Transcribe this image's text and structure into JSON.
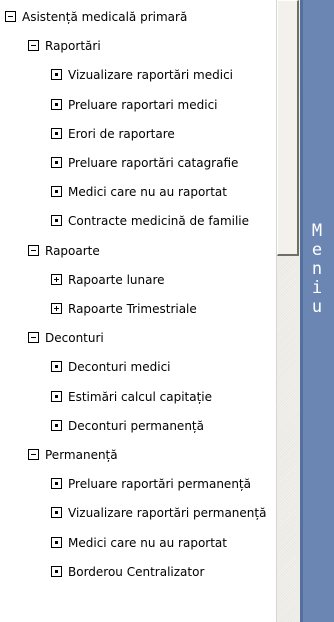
{
  "menu": {
    "title": "Meniu",
    "letters": [
      "M",
      "e",
      "n",
      "i",
      "u"
    ]
  },
  "tree": [
    {
      "label": "Asistență medicală primară",
      "state": "expanded",
      "level": 0
    },
    {
      "label": "Raportări",
      "state": "expanded",
      "level": 1
    },
    {
      "label": "Vizualizare raportări medici",
      "state": "leaf",
      "level": 2
    },
    {
      "label": "Preluare raportari medici",
      "state": "leaf",
      "level": 2
    },
    {
      "label": "Erori de raportare",
      "state": "leaf",
      "level": 2
    },
    {
      "label": "Preluare raportări catagrafie",
      "state": "leaf",
      "level": 2
    },
    {
      "label": "Medici care nu au raportat",
      "state": "leaf",
      "level": 2
    },
    {
      "label": "Contracte medicină de familie",
      "state": "leaf",
      "level": 2
    },
    {
      "label": "Rapoarte",
      "state": "expanded",
      "level": 1
    },
    {
      "label": "Rapoarte lunare",
      "state": "collapsed",
      "level": 2
    },
    {
      "label": "Rapoarte Trimestriale",
      "state": "collapsed",
      "level": 2
    },
    {
      "label": "Deconturi",
      "state": "expanded",
      "level": 1
    },
    {
      "label": "Deconturi medici",
      "state": "leaf",
      "level": 2
    },
    {
      "label": "Estimări calcul capitație",
      "state": "leaf",
      "level": 2
    },
    {
      "label": "Deconturi permanență",
      "state": "leaf",
      "level": 2
    },
    {
      "label": "Permanență",
      "state": "expanded",
      "level": 1
    },
    {
      "label": "Preluare raportări permanență",
      "state": "leaf",
      "level": 2
    },
    {
      "label": "Vizualizare raportări permanență",
      "state": "leaf",
      "level": 2
    },
    {
      "label": "Medici care nu au raportat",
      "state": "leaf",
      "level": 2
    },
    {
      "label": "Borderou Centralizator",
      "state": "leaf",
      "level": 2
    }
  ]
}
